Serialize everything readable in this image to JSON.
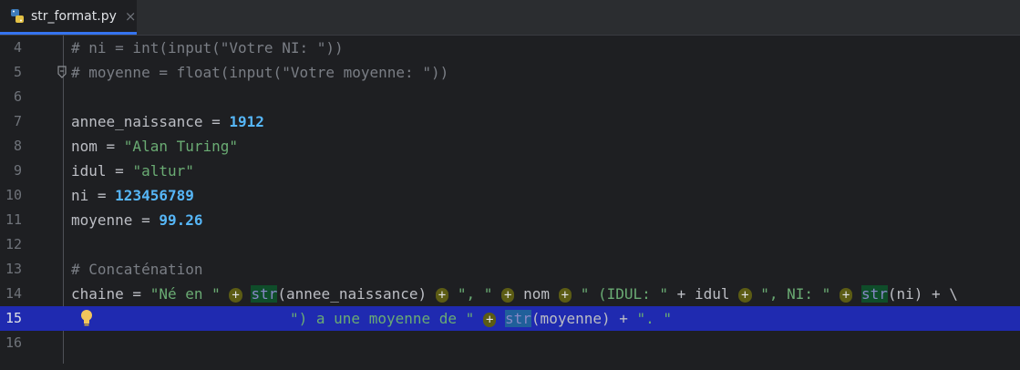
{
  "tab": {
    "title": "str_format.py",
    "close": "×",
    "icon": "python-file-icon"
  },
  "editor": {
    "current_line": 15,
    "lines": [
      {
        "n": "4",
        "code": "# ni = int(input(\"Votre NI: \"))"
      },
      {
        "n": "5",
        "code": "# moyenne = float(input(\"Votre moyenne: \"))"
      },
      {
        "n": "6",
        "code": ""
      },
      {
        "n": "7",
        "code": "annee_naissance = 1912"
      },
      {
        "n": "8",
        "code": "nom = \"Alan Turing\""
      },
      {
        "n": "9",
        "code": "idul = \"altur\""
      },
      {
        "n": "10",
        "code": "ni = 123456789"
      },
      {
        "n": "11",
        "code": "moyenne = 99.26"
      },
      {
        "n": "12",
        "code": ""
      },
      {
        "n": "13",
        "code": "# Concaténation"
      },
      {
        "n": "14",
        "code": "chaine = \"Né en \" + str(annee_naissance) + \", \" + nom + \" (IDUL: \" + idul + \", NI: \" + str(ni) + \\"
      },
      {
        "n": "15",
        "code": "\") a une moyenne de \" + str(moyenne) + \". \""
      },
      {
        "n": "16",
        "code": ""
      }
    ]
  },
  "colors": {
    "background": "#1e1f22",
    "current_line": "#1f2ab0",
    "comment": "#7a7e85",
    "string": "#6aab73",
    "number": "#56b6f7",
    "plus_hint": "#5c5c14"
  }
}
